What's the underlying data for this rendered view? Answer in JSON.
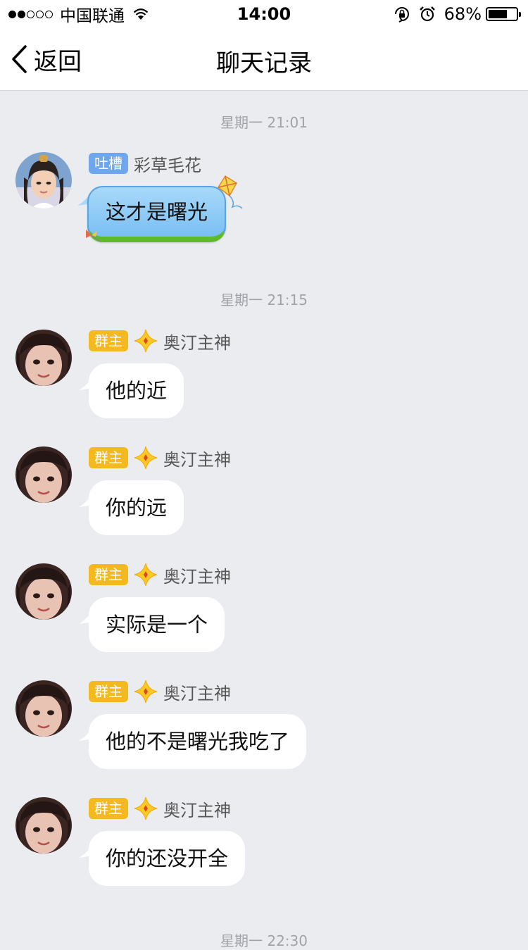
{
  "status_bar": {
    "carrier": "中国联通",
    "time": "14:00",
    "battery": "68%",
    "battery_level": 0.68,
    "signal_bars_filled": 2,
    "signal_bars_total": 5
  },
  "nav": {
    "back_label": "返回",
    "title": "聊天记录"
  },
  "timestamps": [
    "星期一 21:01",
    "星期一 21:15",
    "星期一 22:30"
  ],
  "colors": {
    "background": "#ebecf0",
    "owner_badge": "#f4b91e",
    "tucao_badge": "#6fa7ee",
    "bubble": "#ffffff"
  },
  "messages": [
    {
      "badge": "吐槽",
      "sender": "彩草毛花",
      "text": "这才是曙光"
    },
    {
      "badge": "群主",
      "sender": "奥汀主神",
      "text": "他的近"
    },
    {
      "badge": "群主",
      "sender": "奥汀主神",
      "text": "你的远"
    },
    {
      "badge": "群主",
      "sender": "奥汀主神",
      "text": "实际是一个"
    },
    {
      "badge": "群主",
      "sender": "奥汀主神",
      "text": "他的不是曙光我吃了"
    },
    {
      "badge": "群主",
      "sender": "奥汀主神",
      "text": "你的还没开全"
    }
  ]
}
